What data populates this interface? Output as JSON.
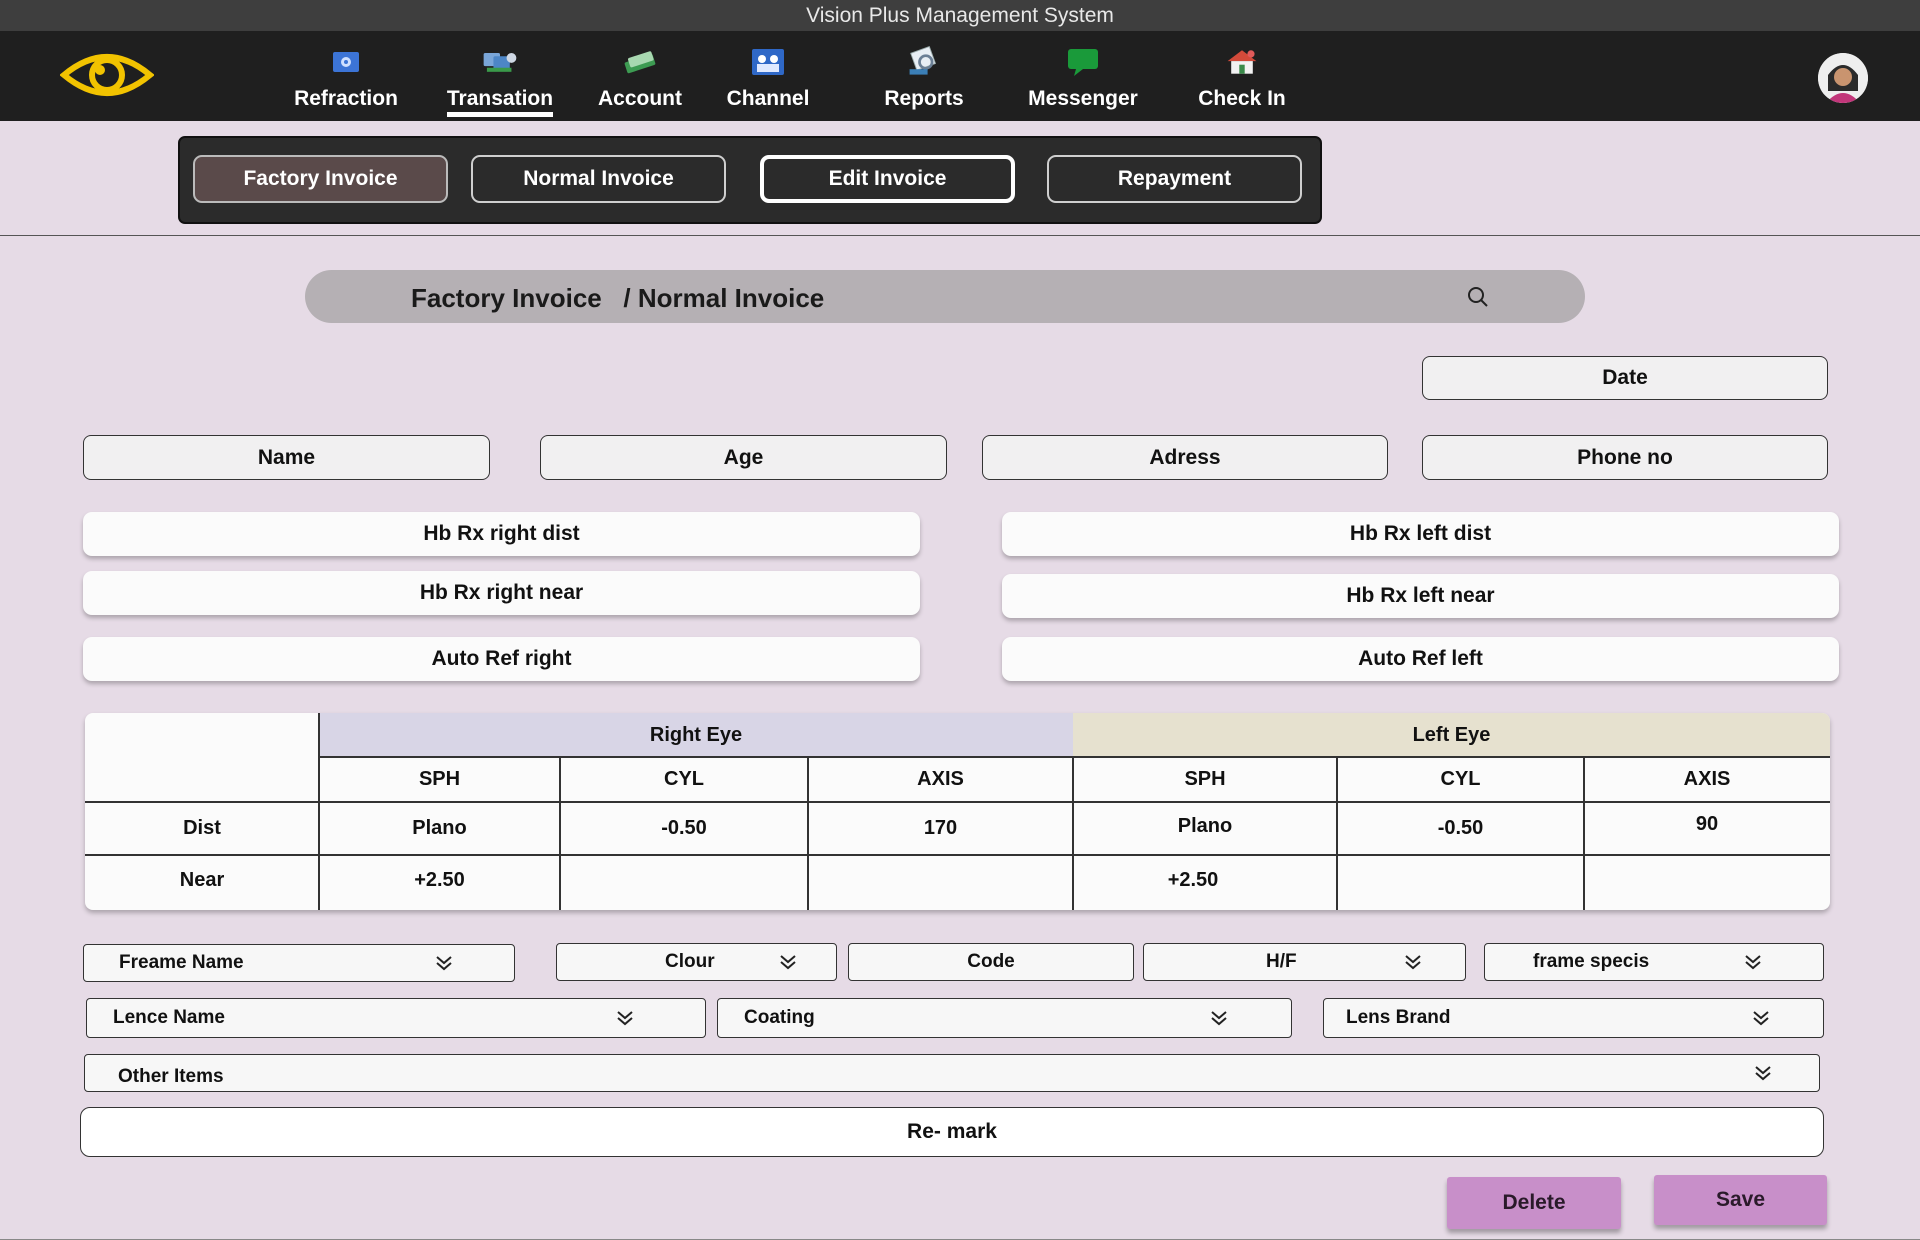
{
  "app": {
    "title": "Vision Plus Management System"
  },
  "nav": {
    "items": [
      {
        "label": "Refraction",
        "icon": "refraction-icon"
      },
      {
        "label": "Transation",
        "icon": "transaction-icon",
        "active": true
      },
      {
        "label": "Account",
        "icon": "account-icon"
      },
      {
        "label": "Channel",
        "icon": "channel-icon"
      },
      {
        "label": "Reports",
        "icon": "reports-icon"
      },
      {
        "label": "Messenger",
        "icon": "messenger-icon"
      },
      {
        "label": "Check In",
        "icon": "check-in-icon"
      }
    ]
  },
  "subtabs": {
    "factory": "Factory Invoice",
    "normal": "Normal Invoice",
    "edit": "Edit Invoice",
    "repayment": "Repayment"
  },
  "search": {
    "title": "Factory Invoice   / Normal Invoice"
  },
  "fields": {
    "date": "Date",
    "name": "Name",
    "age": "Age",
    "address": "Adress",
    "phone": "Phone no"
  },
  "rx": {
    "right_dist": "Hb Rx right dist",
    "left_dist": "Hb Rx left dist",
    "right_near": "Hb Rx right near",
    "left_near": "Hb Rx left near",
    "auto_right": "Auto Ref right",
    "auto_left": "Auto Ref left"
  },
  "table": {
    "right_eye": "Right Eye",
    "left_eye": "Left Eye",
    "headers": [
      "SPH",
      "CYL",
      "AXIS",
      "SPH",
      "CYL",
      "AXIS"
    ],
    "rows": [
      {
        "label": "Dist",
        "values": [
          "Plano",
          "-0.50",
          "170",
          "Plano",
          "-0.50",
          "90"
        ]
      },
      {
        "label": "Near",
        "values": [
          "+2.50",
          "",
          "",
          "+2.50",
          "",
          ""
        ]
      }
    ]
  },
  "dropdowns": {
    "frame_name": "Freame Name",
    "colour": "Clour",
    "code": "Code",
    "hf": "H/F",
    "frame_specs": "frame specis",
    "lens_name": "Lence Name",
    "coating": "Coating",
    "lens_brand": "Lens Brand",
    "other_items": "Other Items"
  },
  "remark": "Re- mark",
  "actions": {
    "delete": "Delete",
    "save": "Save"
  },
  "colors": {
    "accent": "#c88fc9",
    "background": "#e6dbe6",
    "navbar": "#1f1f1f",
    "right_eye_header": "#d8d5e6",
    "left_eye_header": "#e6e1cf"
  }
}
